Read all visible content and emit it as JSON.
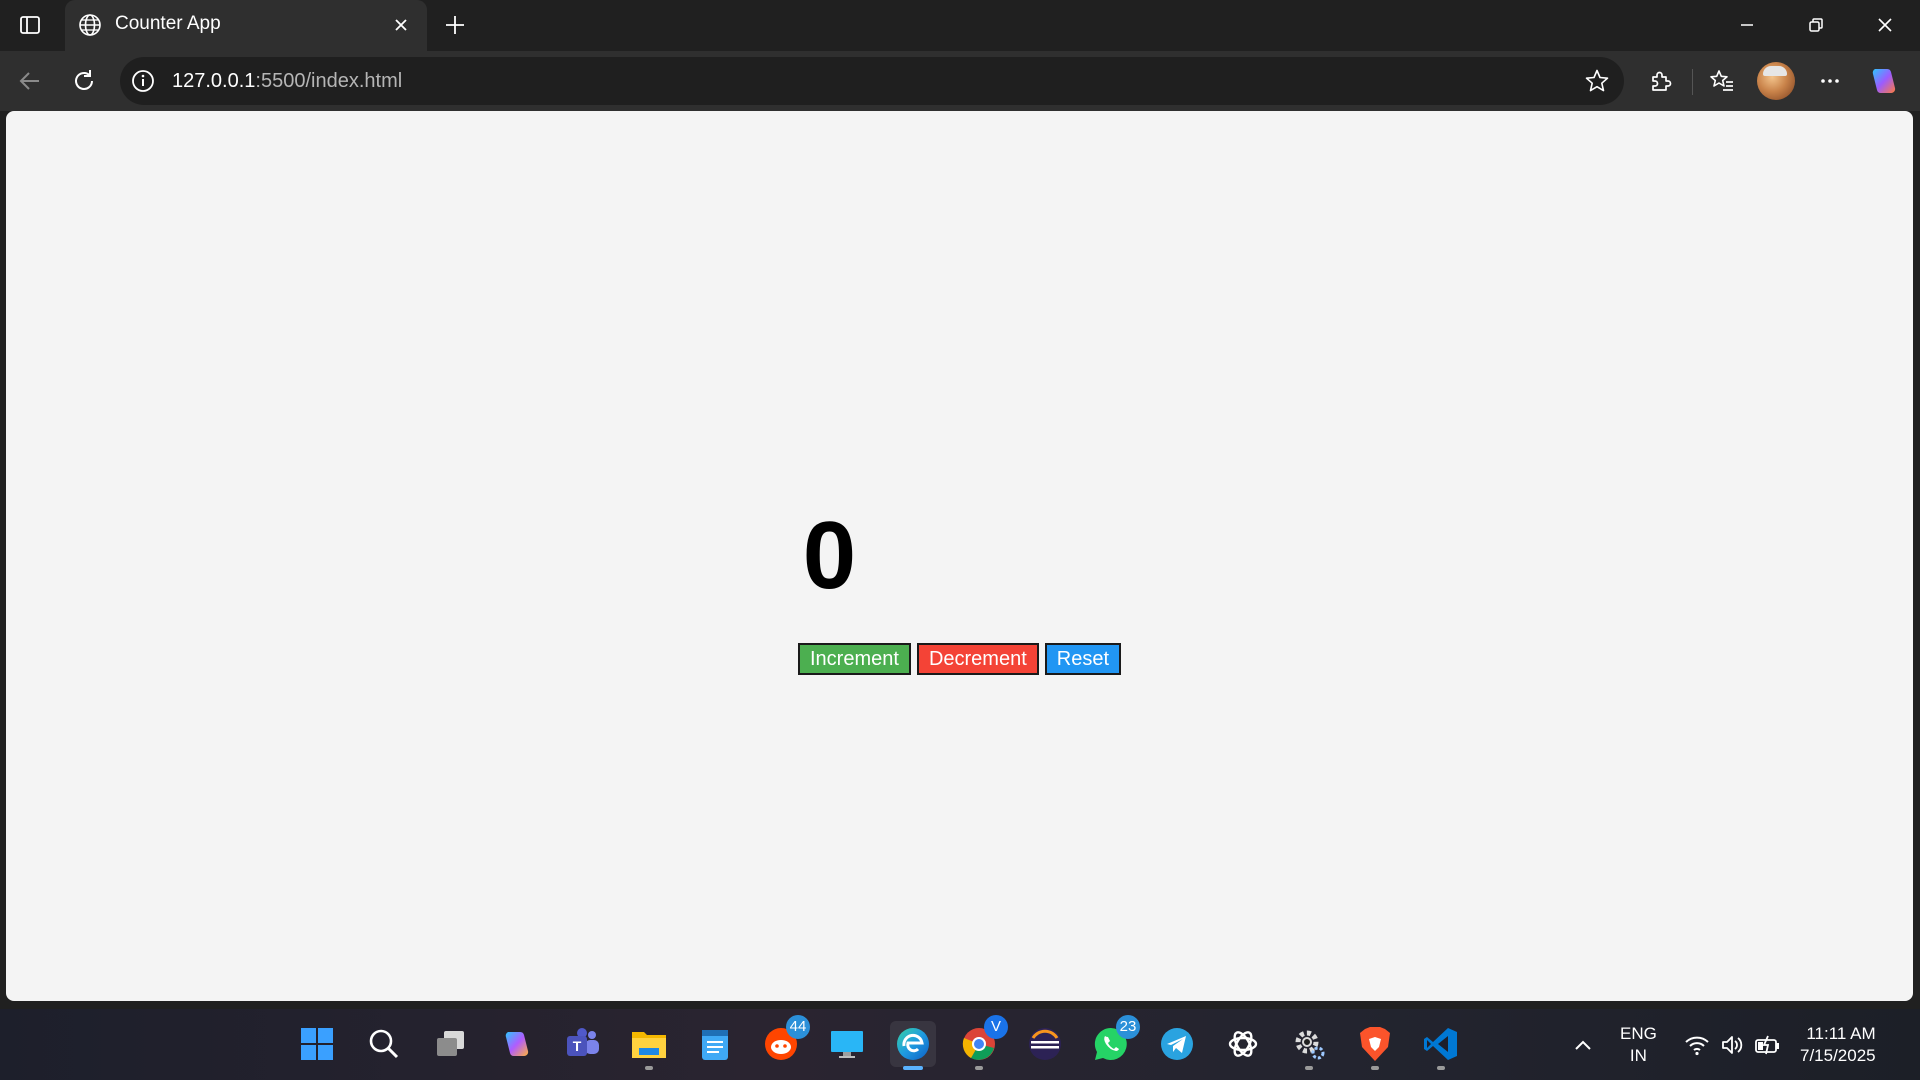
{
  "browser": {
    "tab_title": "Counter App",
    "url_host": "127.0.0.1",
    "url_rest": ":5500/index.html",
    "accent": "#202020"
  },
  "page": {
    "counter_value": "0",
    "buttons": {
      "increment": "Increment",
      "decrement": "Decrement",
      "reset": "Reset"
    },
    "colors": {
      "increment": "#4caf50",
      "decrement": "#f44336",
      "reset": "#2196f3"
    }
  },
  "taskbar": {
    "apps": [
      {
        "icon": "windows-start-icon"
      },
      {
        "icon": "search-icon"
      },
      {
        "icon": "task-view-icon"
      },
      {
        "icon": "copilot-icon"
      },
      {
        "icon": "teams-icon"
      },
      {
        "icon": "file-explorer-icon"
      },
      {
        "icon": "notepad-icon"
      },
      {
        "icon": "reddit-icon",
        "badge": "44"
      },
      {
        "icon": "desktop-icon"
      },
      {
        "icon": "edge-icon"
      },
      {
        "icon": "chrome-icon",
        "badge": "V"
      },
      {
        "icon": "eclipse-icon"
      },
      {
        "icon": "whatsapp-icon",
        "badge": "23"
      },
      {
        "icon": "telegram-icon"
      },
      {
        "icon": "chatgpt-icon"
      },
      {
        "icon": "settings-icon"
      },
      {
        "icon": "brave-icon"
      },
      {
        "icon": "vscode-icon"
      }
    ],
    "language_line1": "ENG",
    "language_line2": "IN",
    "time": "11:11 AM",
    "date": "7/15/2025"
  }
}
